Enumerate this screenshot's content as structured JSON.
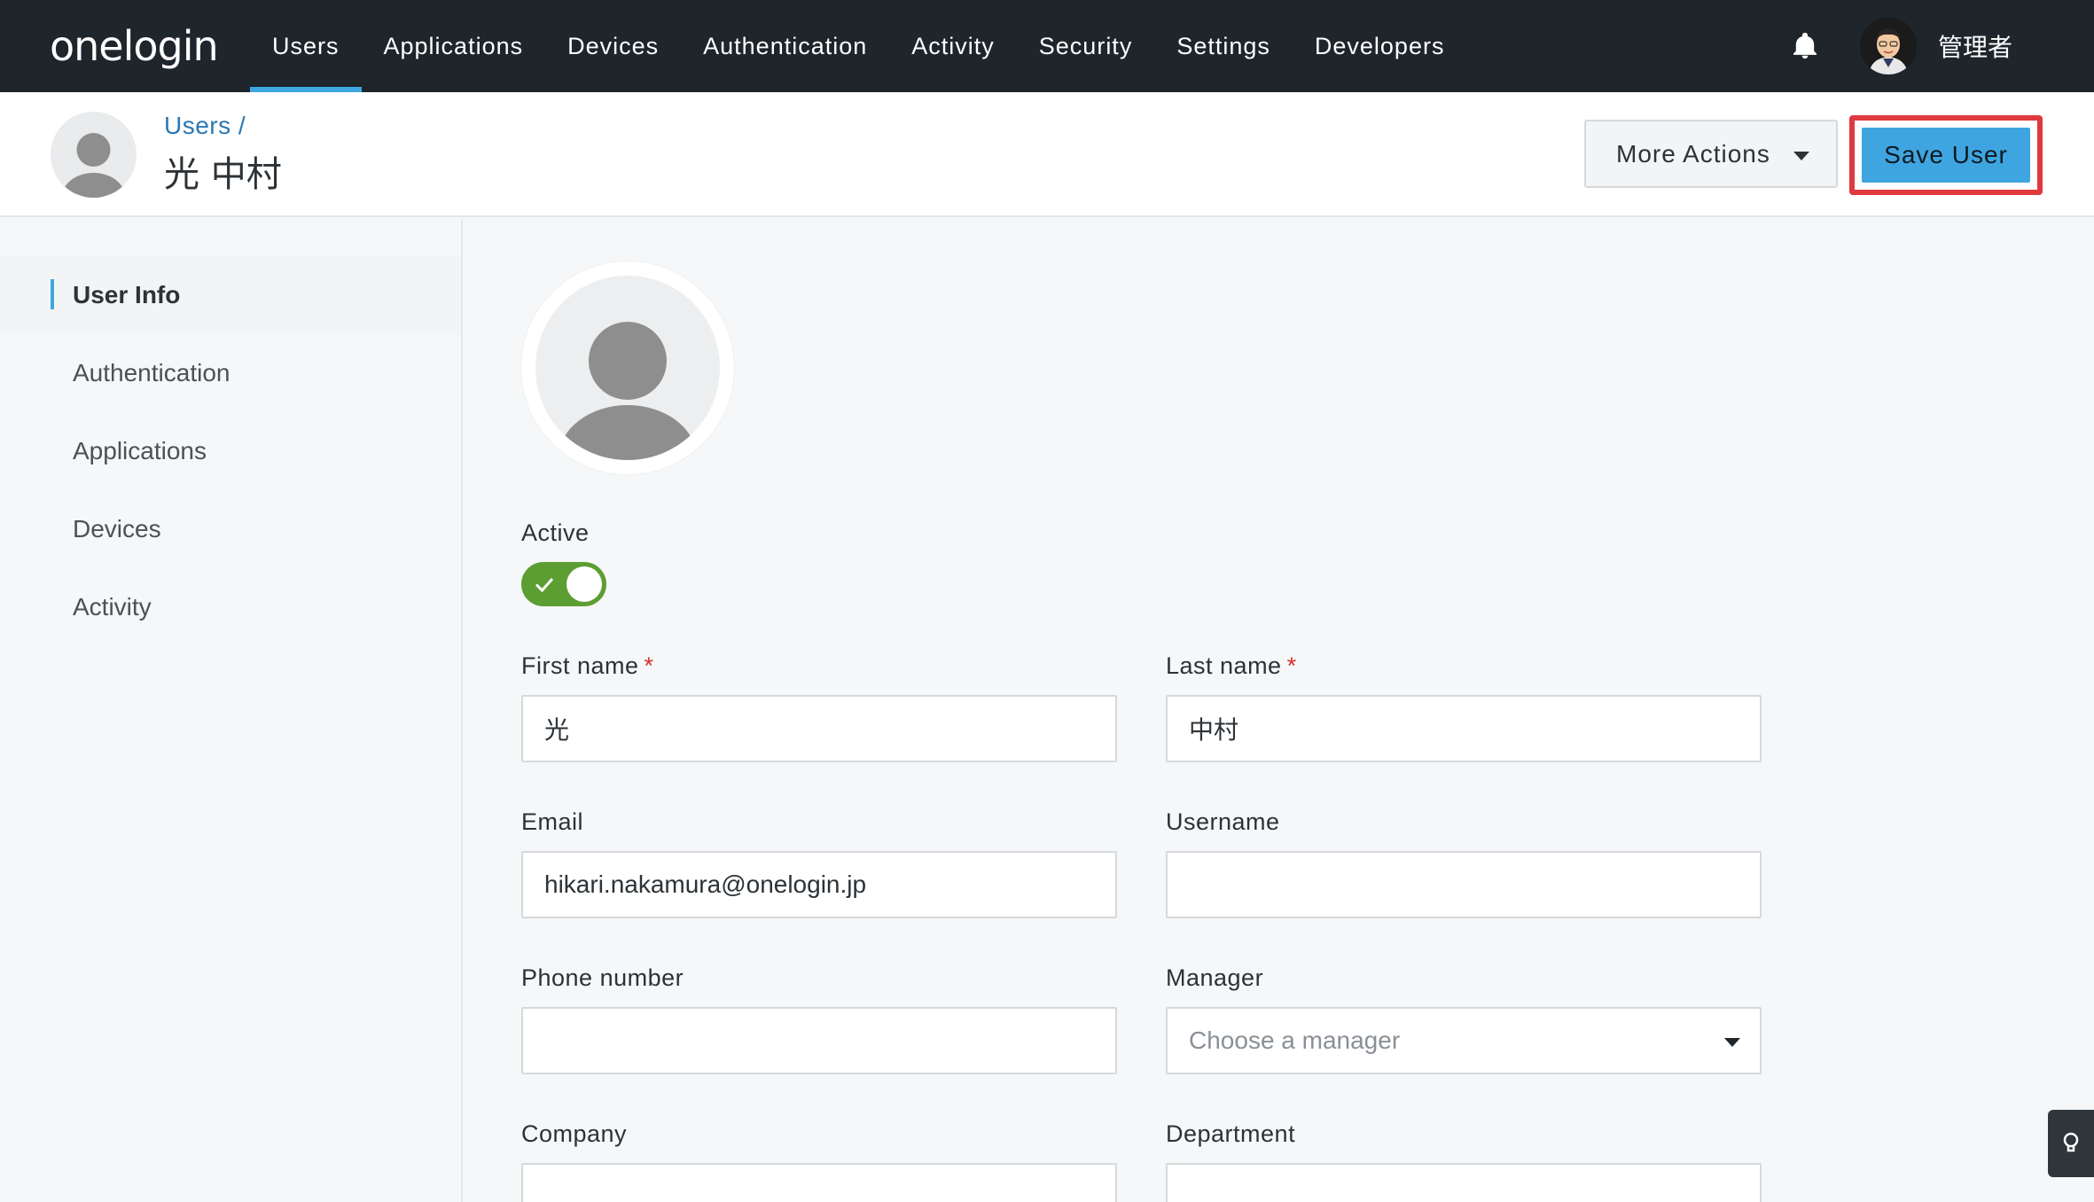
{
  "brand": {
    "logo_text": "onelogin"
  },
  "nav": {
    "items": [
      {
        "label": "Users",
        "active": true
      },
      {
        "label": "Applications",
        "active": false
      },
      {
        "label": "Devices",
        "active": false
      },
      {
        "label": "Authentication",
        "active": false
      },
      {
        "label": "Activity",
        "active": false
      },
      {
        "label": "Security",
        "active": false
      },
      {
        "label": "Settings",
        "active": false
      },
      {
        "label": "Developers",
        "active": false
      }
    ],
    "admin_name": "管理者",
    "accent_color": "#3da8e0"
  },
  "header": {
    "breadcrumb": "Users /",
    "title": "光 中村",
    "more_actions_label": "More Actions",
    "save_label": "Save User"
  },
  "sidebar": {
    "items": [
      {
        "label": "User Info",
        "active": true
      },
      {
        "label": "Authentication",
        "active": false
      },
      {
        "label": "Applications",
        "active": false
      },
      {
        "label": "Devices",
        "active": false
      },
      {
        "label": "Activity",
        "active": false
      }
    ]
  },
  "form": {
    "active_label": "Active",
    "active_on": true,
    "first_name_label": "First name",
    "first_name_value": "光",
    "last_name_label": "Last name",
    "last_name_value": "中村",
    "required_mark": "*",
    "email_label": "Email",
    "email_value": "hikari.nakamura@onelogin.jp",
    "username_label": "Username",
    "username_value": "",
    "phone_label": "Phone number",
    "phone_value": "",
    "manager_label": "Manager",
    "manager_placeholder": "Choose a manager",
    "company_label": "Company",
    "company_value": "",
    "department_label": "Department",
    "department_value": ""
  },
  "colors": {
    "topbar": "#1e252b",
    "save_button": "#3fa5e0",
    "highlight_border": "#e0393e",
    "toggle_on": "#5c9e31"
  },
  "icons": {
    "bell": "bell-icon",
    "help": "lightbulb-icon"
  }
}
